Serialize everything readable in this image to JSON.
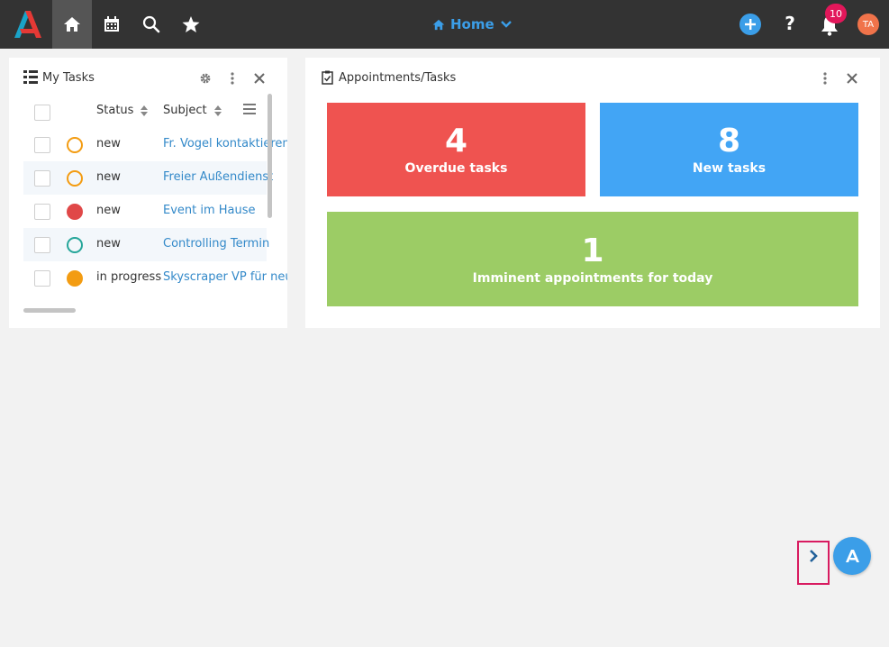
{
  "colors": {
    "topbar": "#333333",
    "accent": "#3b9ee8",
    "overdue": "#ef5350",
    "new": "#42a5f5",
    "imminent": "#9ccc65",
    "badge": "#e2175a",
    "avatar": "#f0734a"
  },
  "topbar": {
    "title": "Home",
    "notifications": "10",
    "avatar_initials": "TA",
    "help_label": "?",
    "icons": [
      "home-icon",
      "calendar-icon",
      "search-icon",
      "star-icon",
      "plus-icon",
      "bell-icon",
      "chevron-down-icon"
    ]
  },
  "tasks_widget": {
    "title": "My Tasks",
    "columns": {
      "status": "Status",
      "subject": "Subject"
    },
    "rows": [
      {
        "status": "new",
        "subject": "Fr. Vogel kontaktieren",
        "indicator": "#f39c12",
        "filled": false
      },
      {
        "status": "new",
        "subject": "Freier Außendienst",
        "indicator": "#f39c12",
        "filled": false
      },
      {
        "status": "new",
        "subject": "Event im Hause",
        "indicator": "#e04848",
        "filled": true
      },
      {
        "status": "new",
        "subject": "Controlling Termin",
        "indicator": "#26a69a",
        "filled": false
      },
      {
        "status": "in progress",
        "subject": "Skyscraper VP für neue",
        "indicator": "#f39c12",
        "filled": true
      }
    ]
  },
  "appointments_widget": {
    "title": "Appointments/Tasks",
    "tiles": {
      "overdue": {
        "count": "4",
        "label": "Overdue tasks"
      },
      "new": {
        "count": "8",
        "label": "New tasks"
      },
      "imminent": {
        "count": "1",
        "label": "Imminent appointments for today"
      }
    }
  }
}
